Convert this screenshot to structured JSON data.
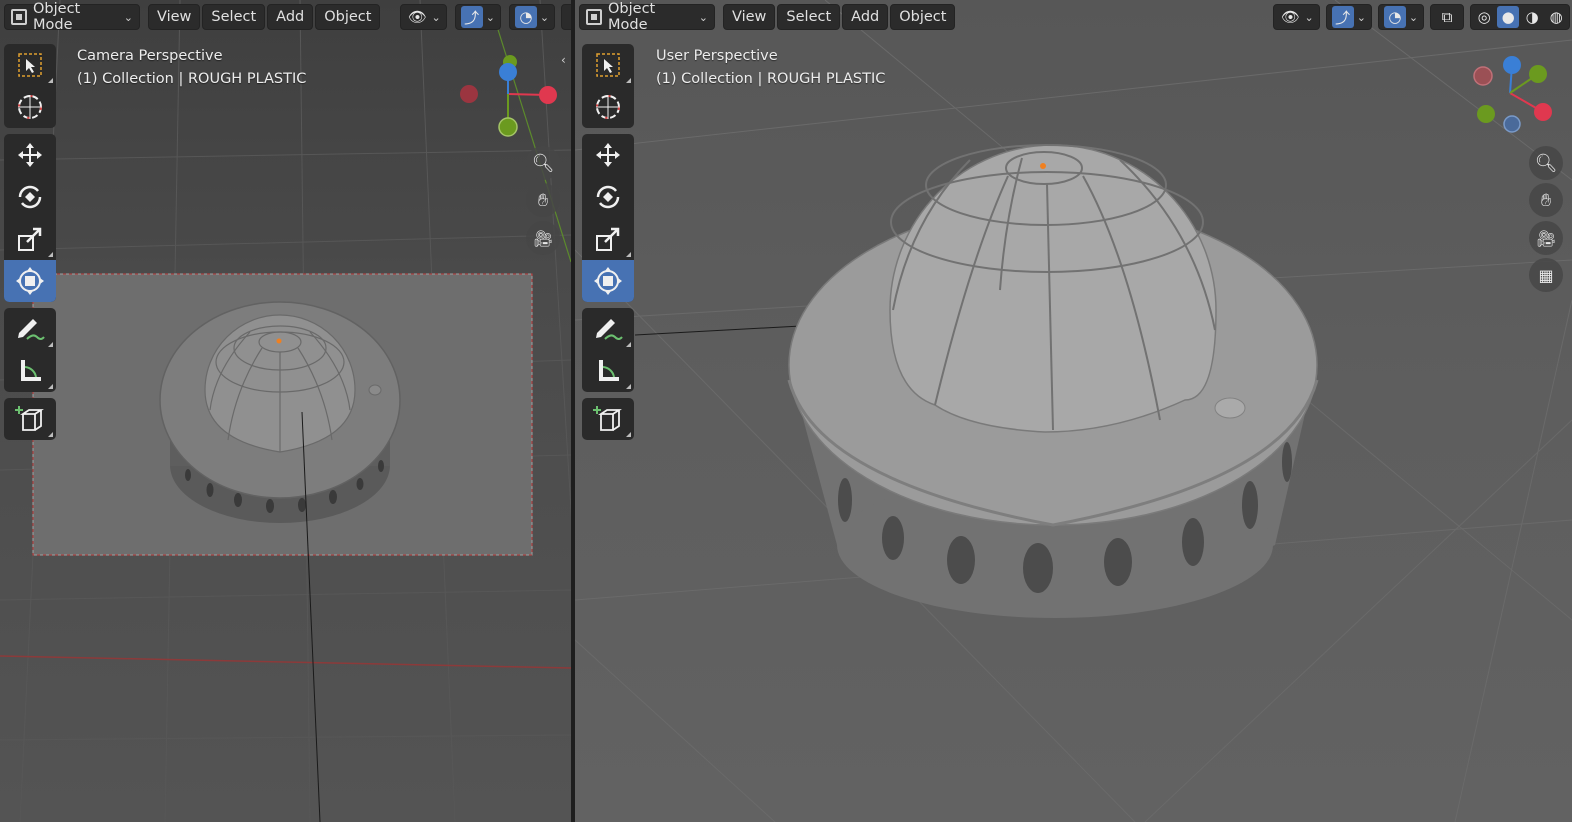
{
  "left_viewport": {
    "mode_label": "Object Mode",
    "menu": [
      "View",
      "Select",
      "Add",
      "Object"
    ],
    "view_name": "Camera Perspective",
    "collection_info": "(1) Collection | ROUGH PLASTIC",
    "gizmo_axes": {
      "z": "Z",
      "y": "Y",
      "x": "X"
    }
  },
  "right_viewport": {
    "mode_label": "Object Mode",
    "menu": [
      "View",
      "Select",
      "Add",
      "Object"
    ],
    "view_name": "User Perspective",
    "collection_info": "(1) Collection | ROUGH PLASTIC",
    "gizmo_axes": {
      "z": "Z",
      "y": "Y",
      "x": "X"
    }
  },
  "toolbar_tools": [
    {
      "name": "select-box",
      "icon": "select-box-icon"
    },
    {
      "name": "cursor",
      "icon": "cursor-icon"
    },
    {
      "name": "move",
      "icon": "move-icon"
    },
    {
      "name": "rotate",
      "icon": "rotate-icon"
    },
    {
      "name": "scale",
      "icon": "scale-icon"
    },
    {
      "name": "transform",
      "icon": "transform-icon",
      "active": true
    },
    {
      "name": "annotate",
      "icon": "annotate-icon"
    },
    {
      "name": "measure",
      "icon": "measure-icon"
    },
    {
      "name": "add-cube",
      "icon": "add-cube-icon"
    }
  ],
  "colors": {
    "active_blue": "#4772b3",
    "axis_x": "#e0384f",
    "axis_y": "#6b9a1f",
    "axis_z": "#3a7fd6",
    "header_bg": "#2b2b2b"
  }
}
